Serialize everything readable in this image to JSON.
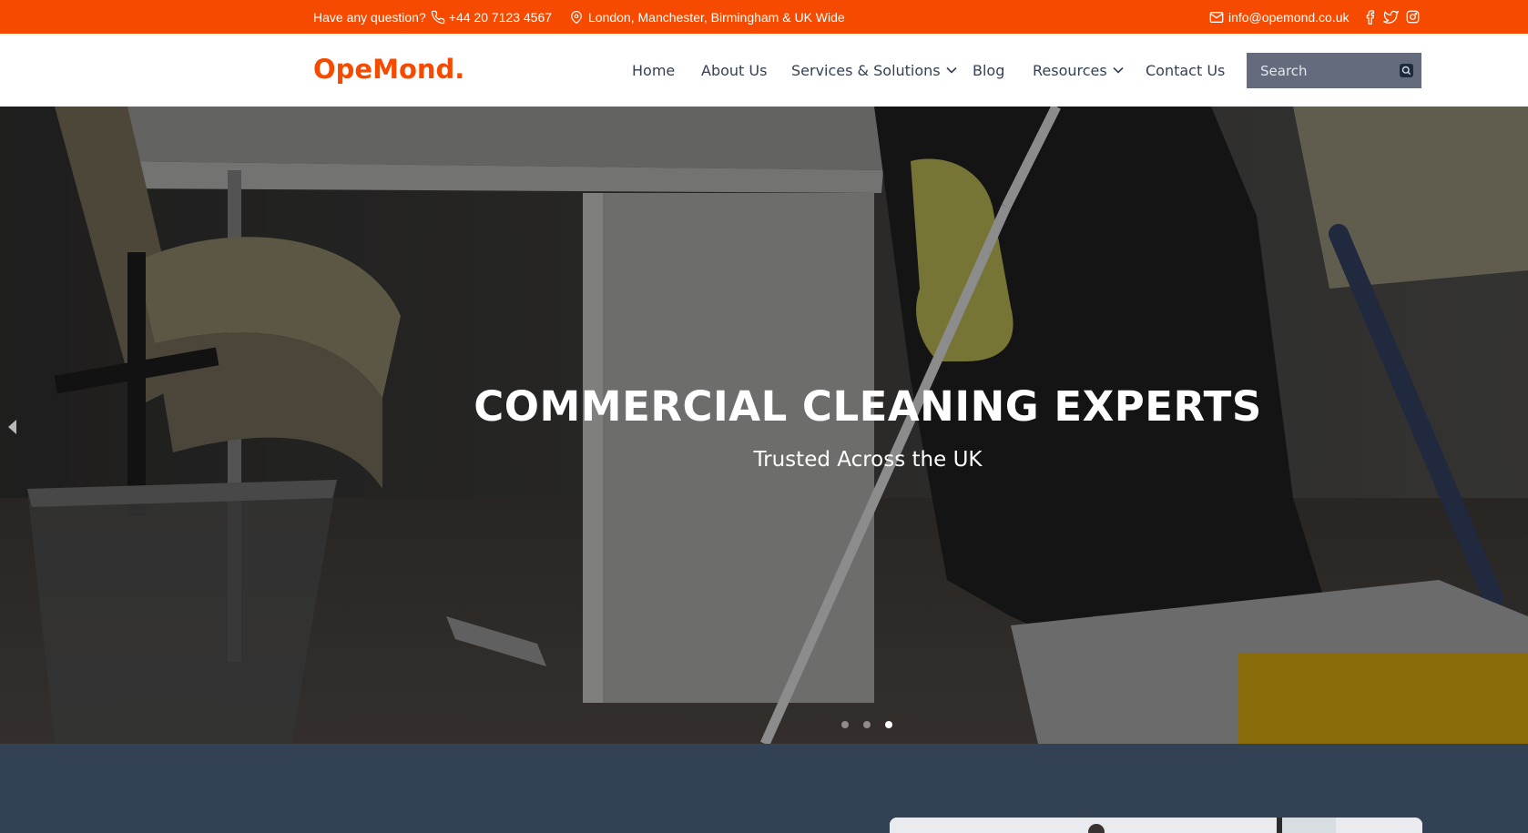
{
  "colors": {
    "brand": "#f54a00",
    "nav_text": "#334155",
    "search_bg": "#646b7d",
    "lower_section": "#334155"
  },
  "topbar": {
    "question_label": "Have any question?",
    "phone": "+44 20 7123 4567",
    "locations": "London, Manchester, Birmingham & UK Wide",
    "email": "info@opemond.co.uk",
    "social_icons": [
      "facebook-icon",
      "twitter-icon",
      "instagram-icon"
    ]
  },
  "navbar": {
    "logo": "OpeMond.",
    "items": [
      {
        "label": "Home"
      },
      {
        "label": "About Us"
      },
      {
        "label": "Services & Solutions",
        "dropdown": true
      },
      {
        "label": "Blog"
      },
      {
        "label": "Resources",
        "dropdown": true
      },
      {
        "label": "Contact Us"
      }
    ],
    "search": {
      "placeholder": "Search",
      "value": ""
    }
  },
  "hero": {
    "title": "COMMERCIAL CLEANING EXPERTS",
    "subtitle": "Trusted Across the UK",
    "slides": 3,
    "active_slide": 3
  }
}
